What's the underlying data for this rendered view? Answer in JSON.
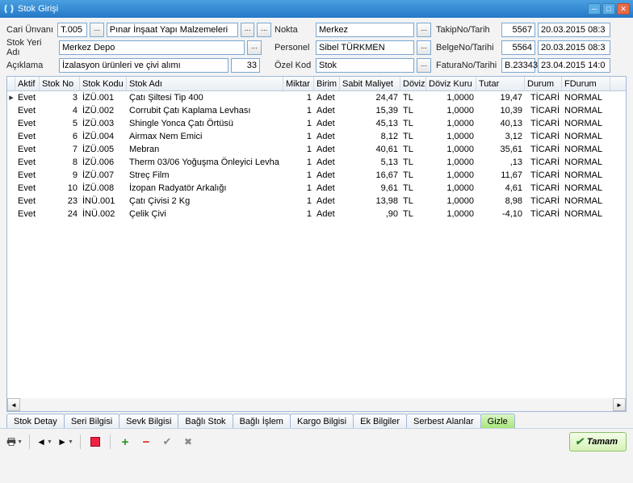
{
  "window": {
    "title": "Stok Girişi"
  },
  "form": {
    "col1": {
      "cari_unvani_lbl": "Cari Ünvanı",
      "cari_kod": "T.005",
      "cari_unvani": "Pınar İnşaat Yapı Malzemeleri A.Ş",
      "stok_yeri_lbl": "Stok Yeri Adı",
      "stok_yeri": "Merkez Depo",
      "aciklama_lbl": "Açıklama",
      "aciklama": "İzalasyon ürünleri ve çivi alımı",
      "aciklama_no": "33"
    },
    "col2": {
      "nokta_lbl": "Nokta",
      "nokta": "Merkez",
      "personel_lbl": "Personel",
      "personel": "Sibel TÜRKMEN",
      "ozel_kod_lbl": "Özel Kod",
      "ozel_kod": "Stok"
    },
    "col3": {
      "takip_lbl": "TakipNo/Tarih",
      "takip_no": "5567",
      "takip_tarih": "20.03.2015 08:3",
      "belge_lbl": "BelgeNo/Tarihi",
      "belge_no": "5564",
      "belge_tarih": "20.03.2015 08:3",
      "fatura_lbl": "FaturaNo/Tarihi",
      "fatura_no": "B.23343",
      "fatura_tarih": "23.04.2015 14:0"
    }
  },
  "grid": {
    "headers": {
      "aktif": "Aktif",
      "stokno": "Stok No",
      "stokkodu": "Stok Kodu",
      "stokadi": "Stok Adı",
      "miktar": "Miktar",
      "birim": "Birim",
      "sabit": "Sabit Maliyet",
      "doviz": "Döviz",
      "kur": "Döviz Kuru",
      "tutar": "Tutar",
      "durum": "Durum",
      "fdurum": "FDurum"
    },
    "rows": [
      {
        "aktif": "Evet",
        "no": "3",
        "kodu": "İZÜ.001",
        "adi": "Çatı Şiltesi Tip 400",
        "miktar": "1",
        "birim": "Adet",
        "sabit": "24,47",
        "doviz": "TL",
        "kur": "1,0000",
        "tutar": "19,47",
        "durum": "TİCARİ",
        "fdurum": "NORMAL",
        "current": true
      },
      {
        "aktif": "Evet",
        "no": "4",
        "kodu": "İZÜ.002",
        "adi": "Corrubit Çatı Kaplama Levhası",
        "miktar": "1",
        "birim": "Adet",
        "sabit": "15,39",
        "doviz": "TL",
        "kur": "1,0000",
        "tutar": "10,39",
        "durum": "TİCARİ",
        "fdurum": "NORMAL"
      },
      {
        "aktif": "Evet",
        "no": "5",
        "kodu": "İZÜ.003",
        "adi": "Shingle Yonca Çatı Örtüsü",
        "miktar": "1",
        "birim": "Adet",
        "sabit": "45,13",
        "doviz": "TL",
        "kur": "1,0000",
        "tutar": "40,13",
        "durum": "TİCARİ",
        "fdurum": "NORMAL"
      },
      {
        "aktif": "Evet",
        "no": "6",
        "kodu": "İZÜ.004",
        "adi": "Airmax Nem Emici",
        "miktar": "1",
        "birim": "Adet",
        "sabit": "8,12",
        "doviz": "TL",
        "kur": "1,0000",
        "tutar": "3,12",
        "durum": "TİCARİ",
        "fdurum": "NORMAL"
      },
      {
        "aktif": "Evet",
        "no": "7",
        "kodu": "İZÜ.005",
        "adi": "Mebran",
        "miktar": "1",
        "birim": "Adet",
        "sabit": "40,61",
        "doviz": "TL",
        "kur": "1,0000",
        "tutar": "35,61",
        "durum": "TİCARİ",
        "fdurum": "NORMAL"
      },
      {
        "aktif": "Evet",
        "no": "8",
        "kodu": "İZÜ.006",
        "adi": "Therm 03/06 Yoğuşma Önleyici Levha",
        "miktar": "1",
        "birim": "Adet",
        "sabit": "5,13",
        "doviz": "TL",
        "kur": "1,0000",
        "tutar": ",13",
        "durum": "TİCARİ",
        "fdurum": "NORMAL"
      },
      {
        "aktif": "Evet",
        "no": "9",
        "kodu": "İZÜ.007",
        "adi": "Streç Film",
        "miktar": "1",
        "birim": "Adet",
        "sabit": "16,67",
        "doviz": "TL",
        "kur": "1,0000",
        "tutar": "11,67",
        "durum": "TİCARİ",
        "fdurum": "NORMAL"
      },
      {
        "aktif": "Evet",
        "no": "10",
        "kodu": "İZÜ.008",
        "adi": "İzopan Radyatör Arkalığı",
        "miktar": "1",
        "birim": "Adet",
        "sabit": "9,61",
        "doviz": "TL",
        "kur": "1,0000",
        "tutar": "4,61",
        "durum": "TİCARİ",
        "fdurum": "NORMAL"
      },
      {
        "aktif": "Evet",
        "no": "23",
        "kodu": "İNÜ.001",
        "adi": "Çatı Çivisi 2 Kg",
        "miktar": "1",
        "birim": "Adet",
        "sabit": "13,98",
        "doviz": "TL",
        "kur": "1,0000",
        "tutar": "8,98",
        "durum": "TİCARİ",
        "fdurum": "NORMAL"
      },
      {
        "aktif": "Evet",
        "no": "24",
        "kodu": "İNÜ.002",
        "adi": "Çelik Çivi",
        "miktar": "1",
        "birim": "Adet",
        "sabit": ",90",
        "doviz": "TL",
        "kur": "1,0000",
        "tutar": "-4,10",
        "durum": "TİCARİ",
        "fdurum": "NORMAL"
      }
    ]
  },
  "tabs": [
    "Stok Detay",
    "Seri Bilgisi",
    "Sevk Bilgisi",
    "Bağlı Stok",
    "Bağlı İşlem",
    "Kargo Bilgisi",
    "Ek Bilgiler",
    "Serbest Alanlar",
    "Gizle"
  ],
  "footer": {
    "tamam": "Tamam"
  }
}
